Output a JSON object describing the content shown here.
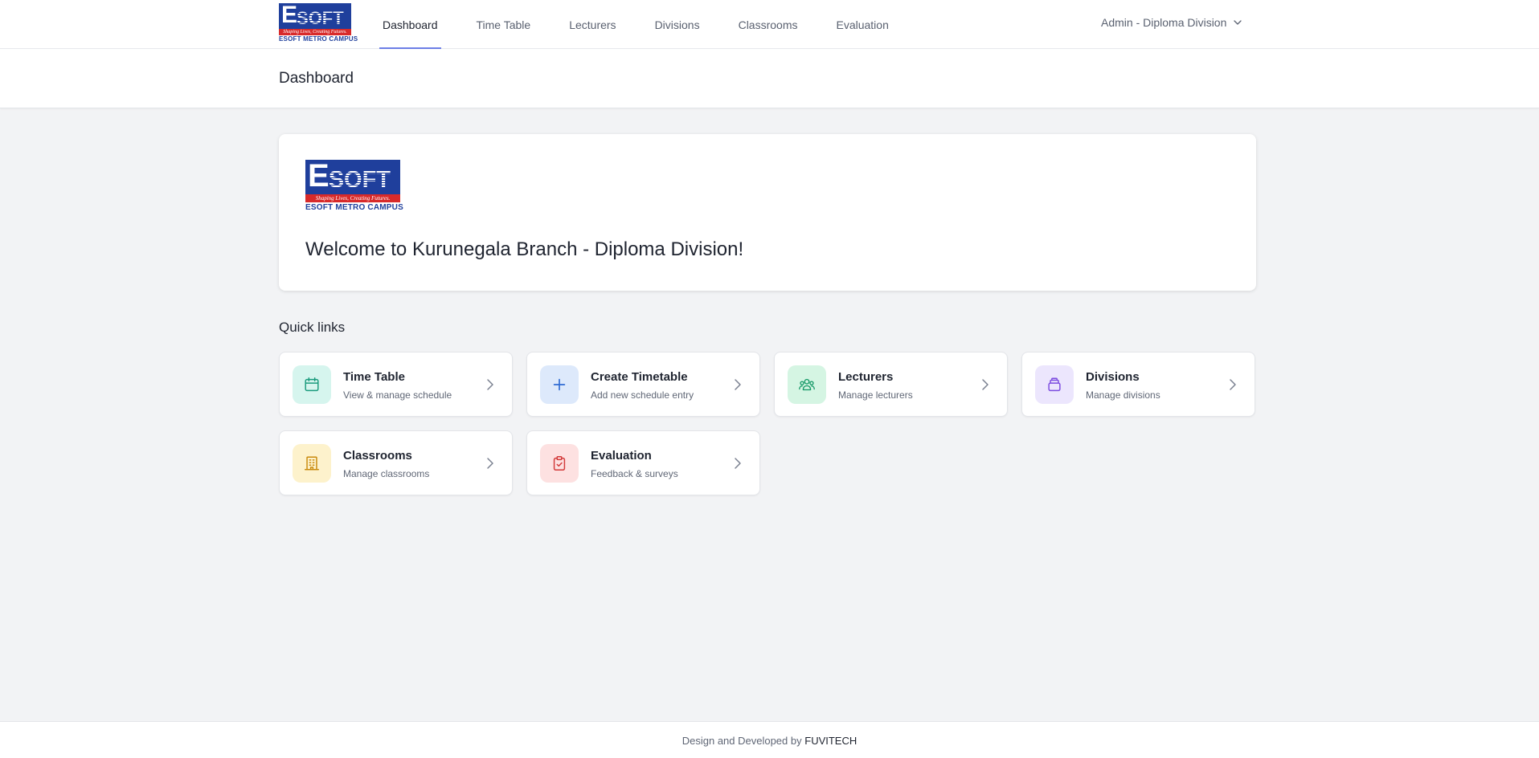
{
  "brand": {
    "logo_mark_e": "E",
    "logo_mark_soft": "SOFT",
    "logo_tagline": "Shaping Lives, Creating Futures.",
    "logo_caption": "ESOFT METRO CAMPUS"
  },
  "nav": {
    "items": [
      {
        "label": "Dashboard",
        "active": true
      },
      {
        "label": "Time Table",
        "active": false
      },
      {
        "label": "Lecturers",
        "active": false
      },
      {
        "label": "Divisions",
        "active": false
      },
      {
        "label": "Classrooms",
        "active": false
      },
      {
        "label": "Evaluation",
        "active": false
      }
    ],
    "user_menu_label": "Admin - Diploma Division",
    "accent_color": "#6d7ee6"
  },
  "page": {
    "title": "Dashboard"
  },
  "welcome": {
    "text": "Welcome to Kurunegala Branch - Diploma Division!"
  },
  "quick_links": {
    "title": "Quick links",
    "items": [
      {
        "title": "Time Table",
        "subtitle": "View & manage schedule",
        "icon": "calendar-icon",
        "icon_bg": "#d6f5ee",
        "icon_color": "#1a9b7d"
      },
      {
        "title": "Create Timetable",
        "subtitle": "Add new schedule entry",
        "icon": "plus-icon",
        "icon_bg": "#dde9fb",
        "icon_color": "#2f6bd3"
      },
      {
        "title": "Lecturers",
        "subtitle": "Manage lecturers",
        "icon": "users-icon",
        "icon_bg": "#d5f5e3",
        "icon_color": "#1a9b6a"
      },
      {
        "title": "Divisions",
        "subtitle": "Manage divisions",
        "icon": "layers-icon",
        "icon_bg": "#ece6fd",
        "icon_color": "#7c4ce0"
      },
      {
        "title": "Classrooms",
        "subtitle": "Manage classrooms",
        "icon": "building-icon",
        "icon_bg": "#fdf2cc",
        "icon_color": "#c98a0c"
      },
      {
        "title": "Evaluation",
        "subtitle": "Feedback & surveys",
        "icon": "clipboard-check-icon",
        "icon_bg": "#fde1e1",
        "icon_color": "#d33a3a"
      }
    ]
  },
  "footer": {
    "prefix": "Design and Developed by",
    "brand": "FUVITECH"
  }
}
